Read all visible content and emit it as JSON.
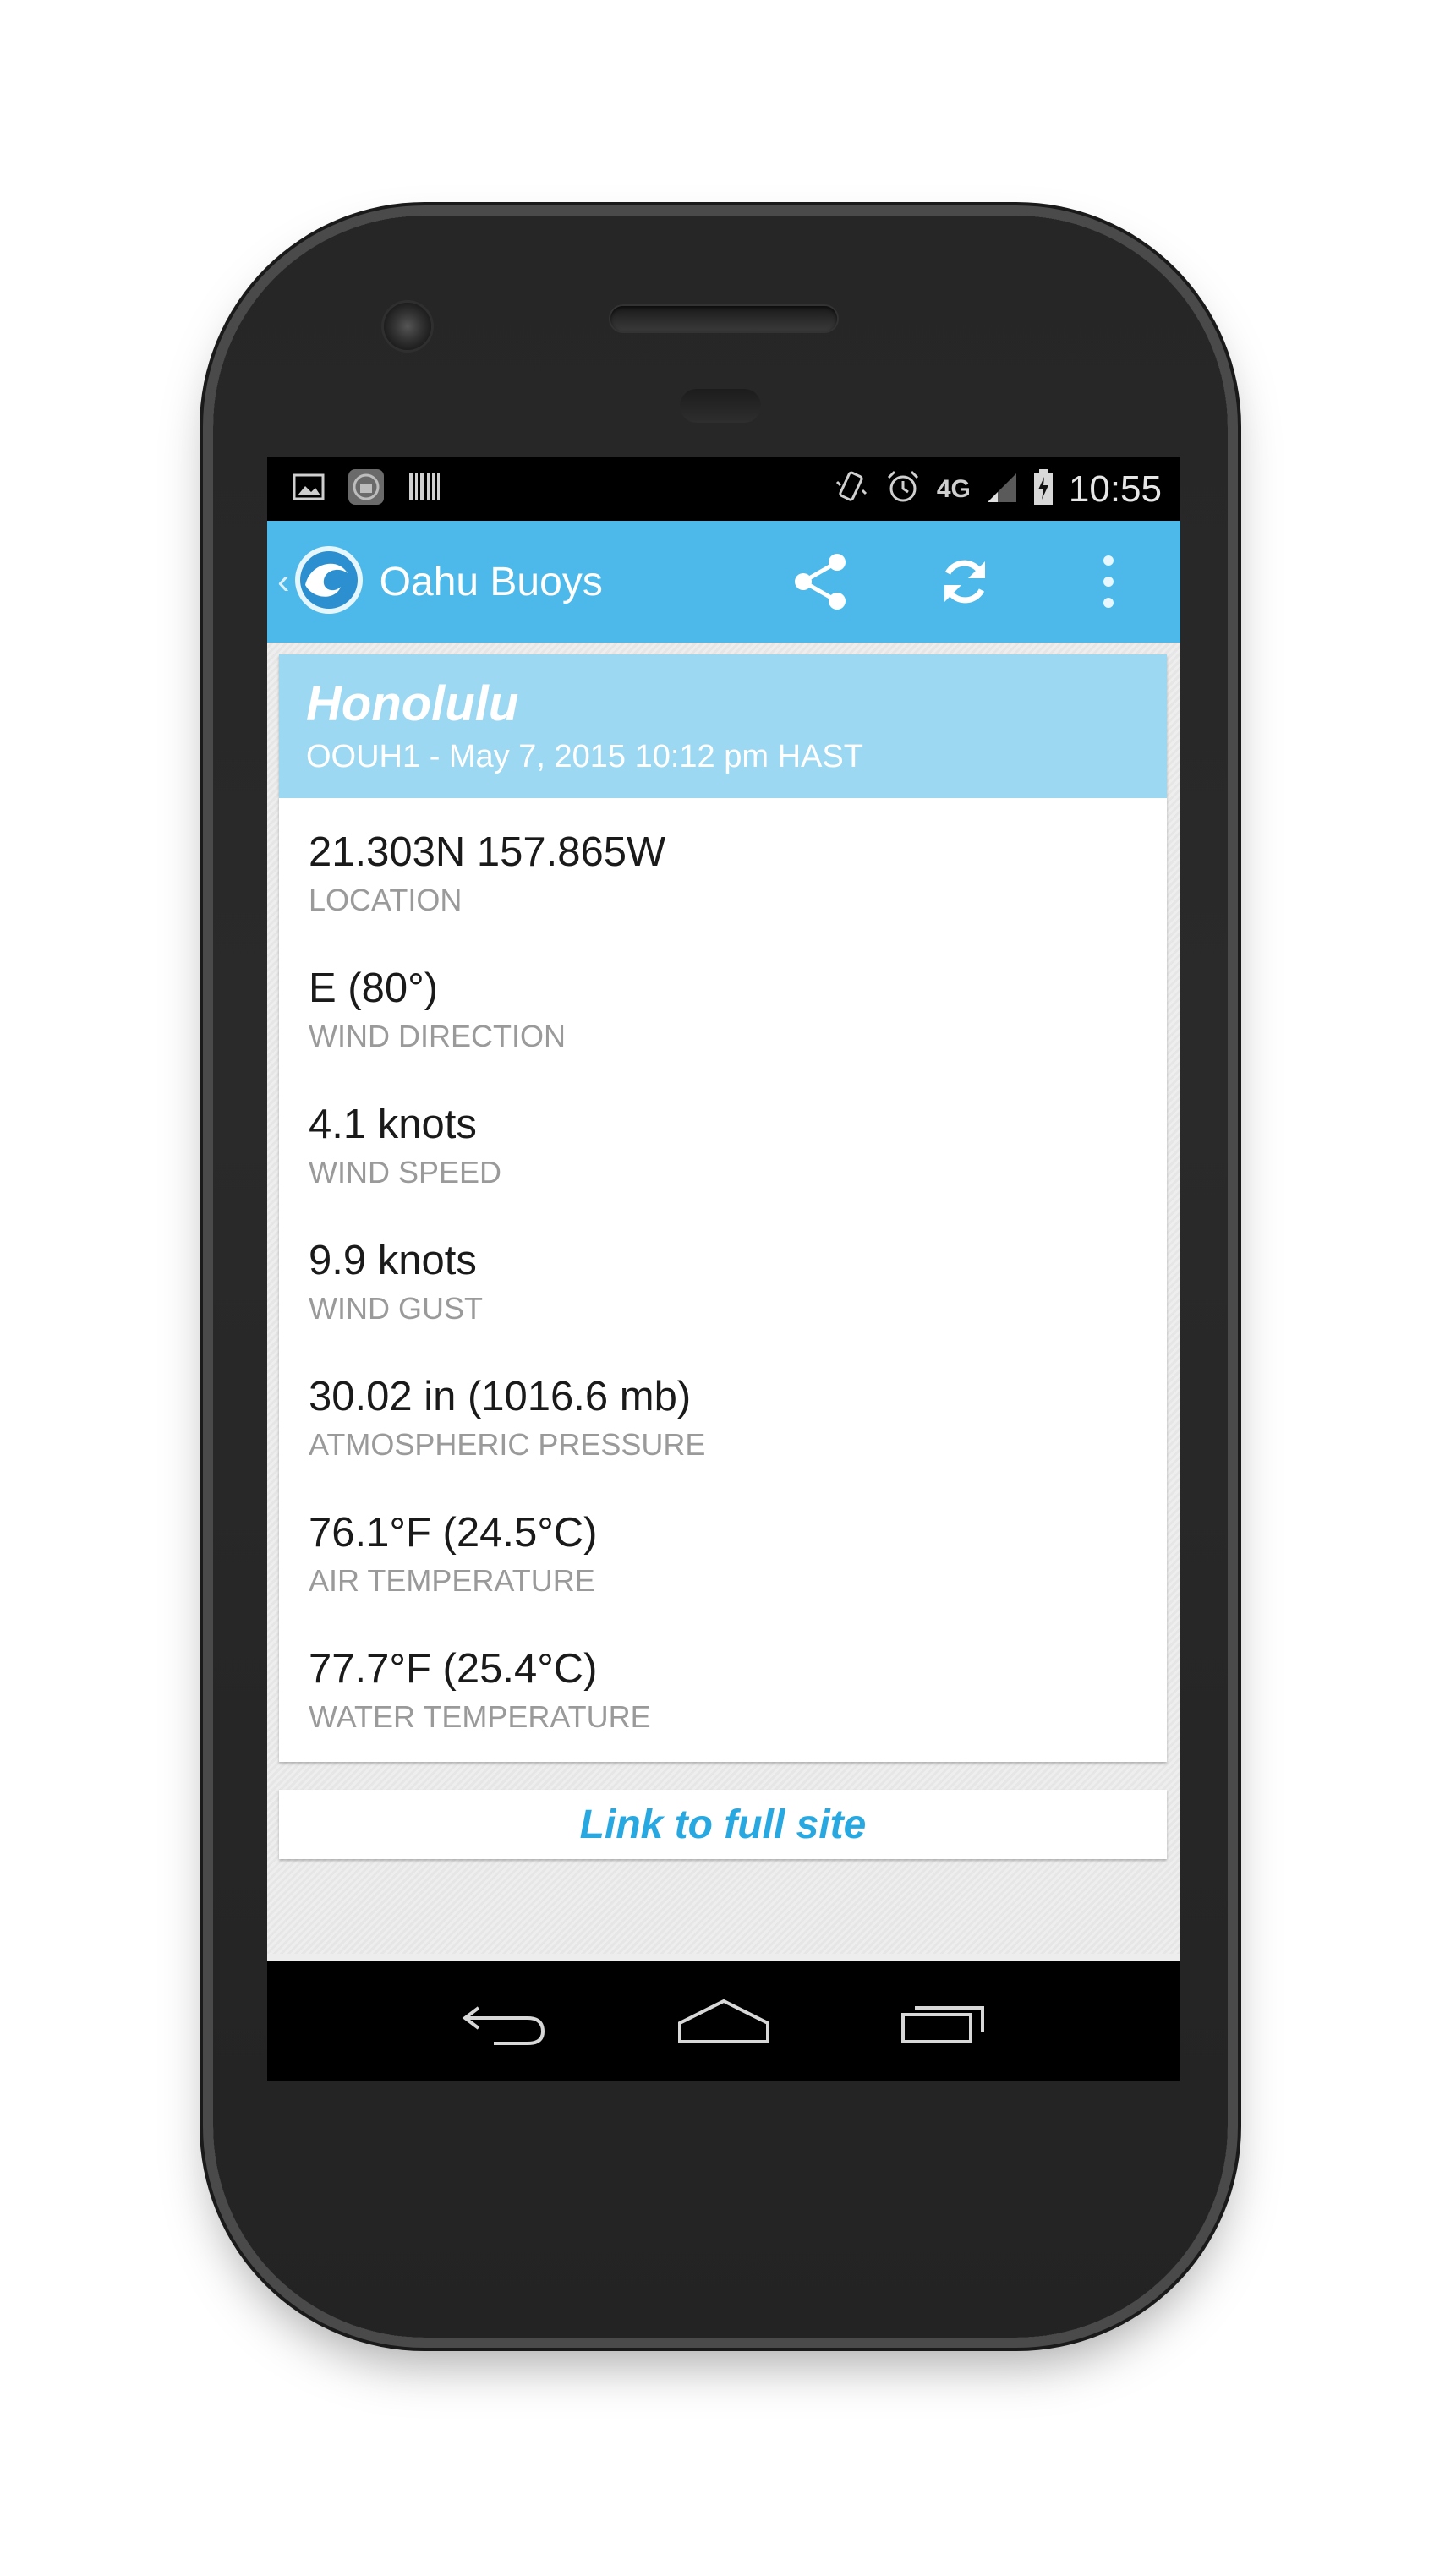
{
  "status_bar": {
    "time": "10:55",
    "network": "4G",
    "left_icons": [
      "image-icon",
      "lock-app-icon",
      "barcode-icon"
    ],
    "right_icons": [
      "vibrate-icon",
      "alarm-icon",
      "signal-icon",
      "battery-charging-icon"
    ]
  },
  "action_bar": {
    "title": "Oahu Buoys",
    "actions": [
      "share-icon",
      "refresh-icon",
      "overflow-menu-icon"
    ],
    "color": "#4cb9ea"
  },
  "station": {
    "name": "Honolulu",
    "subtitle": "OOUH1 - May 7, 2015 10:12 pm HAST"
  },
  "readings": [
    {
      "value": "21.303N 157.865W",
      "label": "LOCATION"
    },
    {
      "value": "E (80°)",
      "label": "WIND DIRECTION"
    },
    {
      "value": "4.1 knots",
      "label": "WIND SPEED"
    },
    {
      "value": "9.9 knots",
      "label": "WIND GUST"
    },
    {
      "value": "30.02 in (1016.6 mb)",
      "label": "ATMOSPHERIC PRESSURE"
    },
    {
      "value": "76.1°F (24.5°C)",
      "label": "AIR TEMPERATURE"
    },
    {
      "value": "77.7°F (25.4°C)",
      "label": "WATER TEMPERATURE"
    }
  ],
  "link": {
    "label": "Link to full site"
  },
  "nav_bar": [
    "back-icon",
    "home-icon",
    "recents-icon"
  ]
}
